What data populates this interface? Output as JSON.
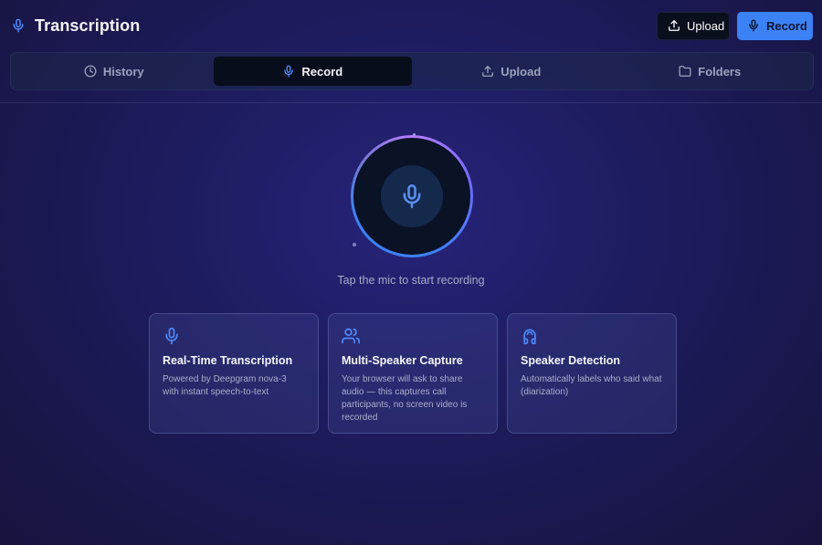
{
  "header": {
    "title": "Transcription",
    "title_icon": "mic-icon",
    "upload_label": "Upload",
    "record_label": "Record"
  },
  "tabs": [
    {
      "label": "History",
      "icon": "clock-icon",
      "active": false
    },
    {
      "label": "Record",
      "icon": "mic-icon",
      "active": true
    },
    {
      "label": "Upload",
      "icon": "upload-icon",
      "active": false
    },
    {
      "label": "Folders",
      "icon": "folder-icon",
      "active": false
    }
  ],
  "recorder": {
    "hint": "Tap the mic to start recording"
  },
  "features": [
    {
      "icon": "mic-icon",
      "title": "Real-Time Transcription",
      "description": "Powered by Deepgram nova-3 with instant speech-to-text"
    },
    {
      "icon": "users-icon",
      "title": "Multi-Speaker Capture",
      "description": "Your browser will ask to share audio — this captures call participants, no screen video is recorded"
    },
    {
      "icon": "speech-detection-icon",
      "title": "Speaker Detection",
      "description": "Automatically labels who said what (diarization)"
    }
  ],
  "colors": {
    "accent": "#3b82f6",
    "icon_blue": "#4f8cff",
    "background": "#1f1d63",
    "ring_purple": "#b57bff"
  }
}
